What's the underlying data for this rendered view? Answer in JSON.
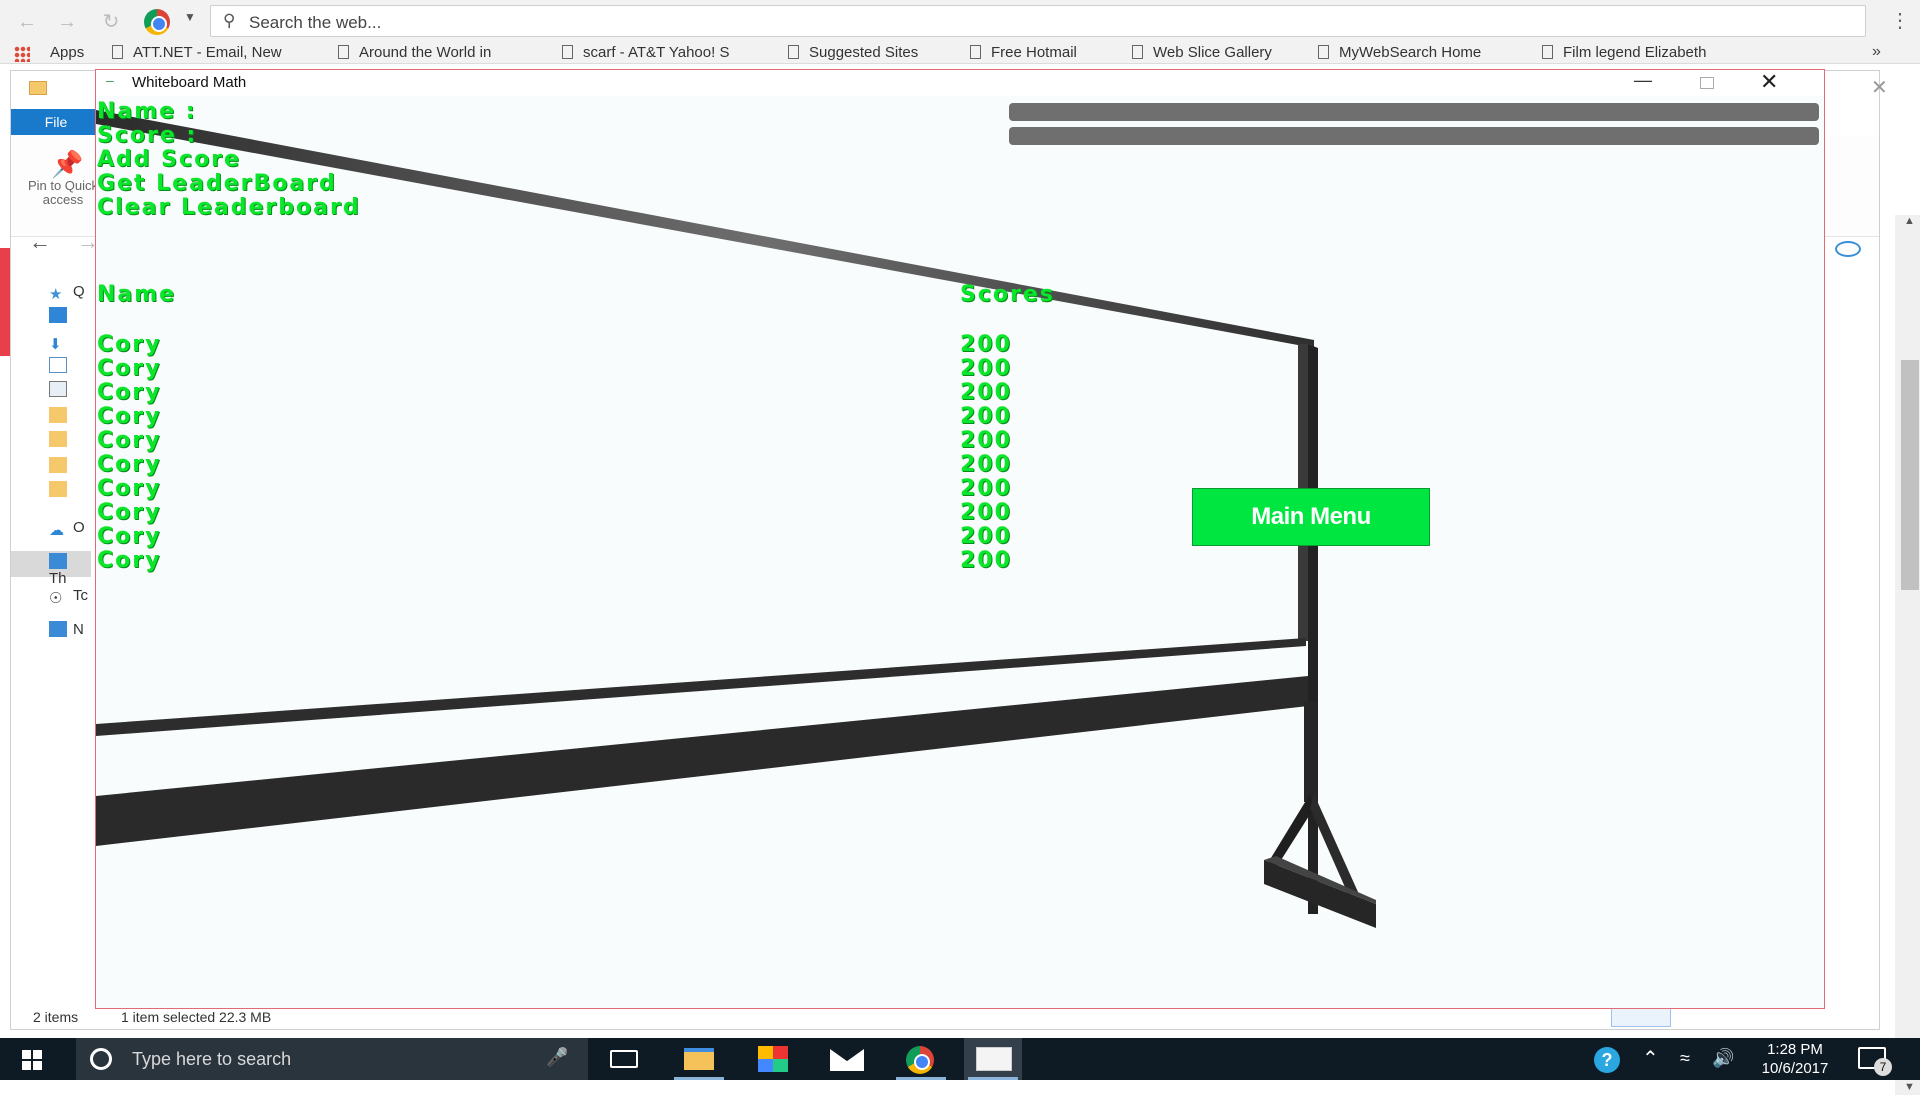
{
  "browser": {
    "search_placeholder": "Search the web...",
    "apps_label": "Apps",
    "bookmarks": [
      "ATT.NET - Email, New",
      "Around the World in",
      "scarf - AT&T Yahoo! S",
      "Suggested Sites",
      "Free Hotmail",
      "Web Slice Gallery",
      "MyWebSearch Home",
      "Film legend Elizabeth"
    ],
    "more_label": "»"
  },
  "explorer": {
    "file_tab": "File",
    "pin_label": "Pin to Quick access",
    "nav_items": [
      "Q",
      "",
      "",
      "",
      "",
      "",
      "",
      "",
      "O",
      "Th",
      "Tc",
      "N"
    ],
    "status_items": "2 items",
    "status_selected": "1 item selected  22.3 MB"
  },
  "game_window": {
    "title": "Whiteboard Math",
    "menu": {
      "name_label": "Name :",
      "score_label": "Score :",
      "add_score": "Add Score",
      "get_leaderboard": "Get LeaderBoard",
      "clear_leaderboard": "Clear Leaderboard"
    },
    "name_input_value": "",
    "score_input_value": "",
    "leaderboard": {
      "name_header": "Name",
      "score_header": "Scores",
      "rows": [
        {
          "name": "Cory",
          "score": "200"
        },
        {
          "name": "Cory",
          "score": "200"
        },
        {
          "name": "Cory",
          "score": "200"
        },
        {
          "name": "Cory",
          "score": "200"
        },
        {
          "name": "Cory",
          "score": "200"
        },
        {
          "name": "Cory",
          "score": "200"
        },
        {
          "name": "Cory",
          "score": "200"
        },
        {
          "name": "Cory",
          "score": "200"
        },
        {
          "name": "Cory",
          "score": "200"
        },
        {
          "name": "Cory",
          "score": "200"
        }
      ]
    },
    "main_menu_button": "Main Menu",
    "text_color": "#0ae62a",
    "button_color": "#00e640"
  },
  "taskbar": {
    "search_placeholder": "Type here to search",
    "time": "1:28 PM",
    "date": "10/6/2017",
    "notification_count": "7",
    "icons": [
      "windows-start-icon",
      "cortana-icon",
      "microphone-icon",
      "task-view-icon",
      "file-explorer-icon",
      "paint-icon",
      "mail-icon",
      "chrome-icon",
      "whiteboard-math-icon"
    ]
  }
}
